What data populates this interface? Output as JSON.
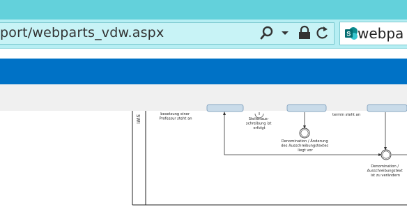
{
  "browser": {
    "url": "port/webparts_vdw.aspx",
    "tab_title": "webpa"
  },
  "diagram": {
    "lane_label": "SWI",
    "nodes": [
      {
        "lines": [
          "besetzung einer",
          "Professur steht an"
        ]
      },
      {
        "lines": [
          "Stellenaus-",
          "schreibung ist",
          "erfolgt"
        ]
      },
      {
        "lines": [
          "termin steht an"
        ]
      },
      {
        "lines": [
          "Denomination / Änderung",
          "des Ausschreibungstextes",
          "liegt vor"
        ]
      },
      {
        "lines": [
          "Denomination /",
          "Ausschreibungstext",
          "ist zu verändern"
        ]
      }
    ]
  }
}
